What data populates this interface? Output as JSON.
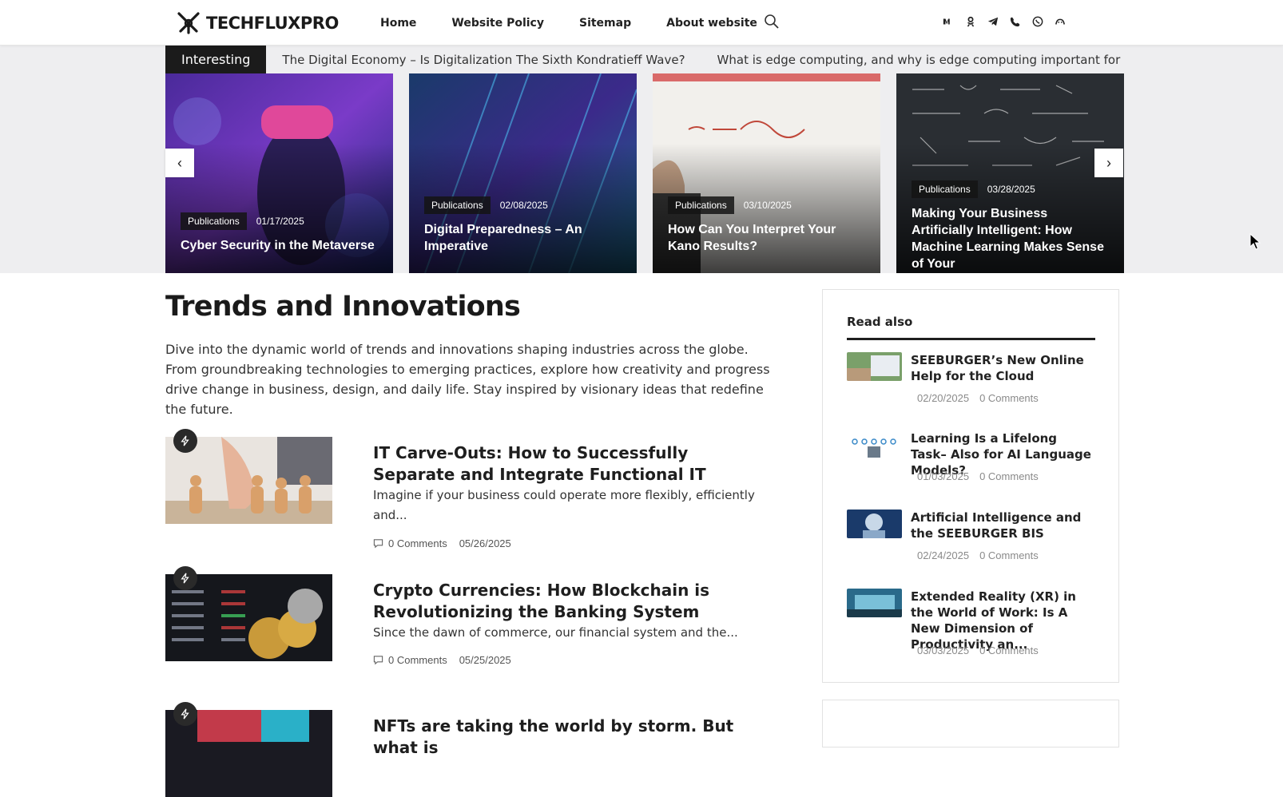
{
  "header": {
    "logo_text": "TECHFLUXPRO",
    "nav": [
      {
        "label": "Home"
      },
      {
        "label": "Website Policy"
      },
      {
        "label": "Sitemap"
      },
      {
        "label": "About website"
      }
    ],
    "search_icon": "search-icon",
    "socials": [
      "vk-icon",
      "odnoklassniki-icon",
      "telegram-icon",
      "viber-icon",
      "whatsapp-icon",
      "max-icon"
    ]
  },
  "ticker": {
    "label": "Interesting",
    "items": [
      "The Digital Economy – Is Digitalization The Sixth Kondratieff Wave?",
      "What is edge computing, and why is edge computing important for proces"
    ]
  },
  "carousel": {
    "prev": "‹",
    "next": "›",
    "slides": [
      {
        "category": "Publications",
        "date": "01/17/2025",
        "title": "Cyber Security in the Metaverse"
      },
      {
        "category": "Publications",
        "date": "02/08/2025",
        "title": "Digital Preparedness – An Imperative"
      },
      {
        "category": "Publications",
        "date": "03/10/2025",
        "title": "How Can You Interpret Your Kano Results?"
      },
      {
        "category": "Publications",
        "date": "03/28/2025",
        "title": "Making Your Business Artificially Intelligent: How Machine Learning Makes Sense of Your"
      }
    ]
  },
  "main": {
    "title": "Trends and Innovations",
    "description": "Dive into the dynamic world of trends and innovations shaping industries across the globe. From groundbreaking technologies to emerging practices, explore how creativity and progress drive change in business, design, and daily life. Stay inspired by visionary ideas that redefine the future.",
    "posts": [
      {
        "title": "IT Carve-Outs: How to Successfully Separate and Integrate Functional IT",
        "excerpt": "Imagine if your business could operate more flexibly, efficiently and...",
        "comments": "0 Comments",
        "date": "05/26/2025"
      },
      {
        "title": "Crypto Currencies: How Blockchain is Revolutionizing the Banking System",
        "excerpt": "Since the dawn of commerce, our financial system and the...",
        "comments": "0 Comments",
        "date": "05/25/2025"
      },
      {
        "title": "NFTs are taking the world by storm. But what is",
        "excerpt": "",
        "comments": "",
        "date": ""
      }
    ]
  },
  "sidebar": {
    "title": "Read also",
    "items": [
      {
        "title": "SEEBURGER’s New Online Help for the Cloud",
        "date": "02/20/2025",
        "comments": "0 Comments"
      },
      {
        "title": "Learning Is a Lifelong Task– Also for AI Language Models?",
        "date": "01/03/2025",
        "comments": "0 Comments"
      },
      {
        "title": "Artificial Intelligence and the SEEBURGER BIS",
        "date": "02/24/2025",
        "comments": "0 Comments"
      },
      {
        "title": "Extended Reality (XR) in the World of Work: Is A New Dimension of Productivity an...",
        "date": "03/03/2025",
        "comments": "0 Comments"
      }
    ]
  }
}
